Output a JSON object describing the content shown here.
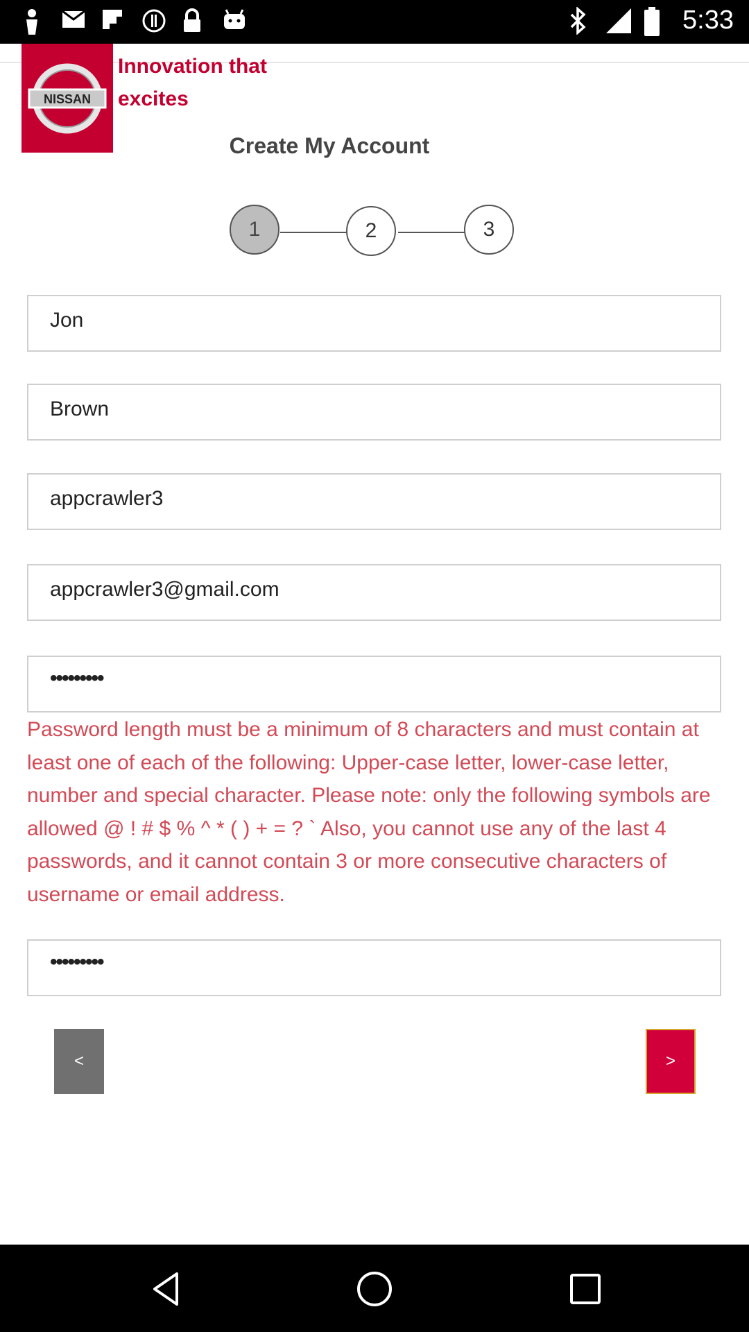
{
  "status_bar": {
    "time": "5:33",
    "left_icons": [
      "person-icon",
      "mail-icon",
      "flipboard-icon",
      "circle-icon",
      "lock-icon",
      "android-icon"
    ],
    "right_icons": [
      "bluetooth-icon",
      "signal-icon",
      "battery-icon"
    ]
  },
  "header": {
    "logo_text": "NISSAN",
    "tagline": "Innovation that excites",
    "title": "Create My Account"
  },
  "stepper": {
    "steps": [
      "1",
      "2",
      "3"
    ],
    "active_step": 1
  },
  "form": {
    "first_name": "Jon",
    "last_name": "Brown",
    "username": "appcrawler3",
    "email": "appcrawler3@gmail.com",
    "password": "•••••••••",
    "password_error": "Password length must be a minimum of 8 characters and must contain at least one of each of the following: Upper-case letter, lower-case letter, number and special character. Please note: only the following symbols are allowed @ ! # $ % ^ * ( ) + = ? ` Also, you cannot use any of the last 4 passwords, and it cannot contain 3 or more consecutive characters of username or email address.",
    "confirm_password": "•••••••••"
  },
  "buttons": {
    "back_label": "<",
    "next_label": ">"
  },
  "colors": {
    "brand": "#c3002f",
    "error": "#d24a56",
    "back_button": "#707070",
    "next_button": "#d2003a"
  }
}
